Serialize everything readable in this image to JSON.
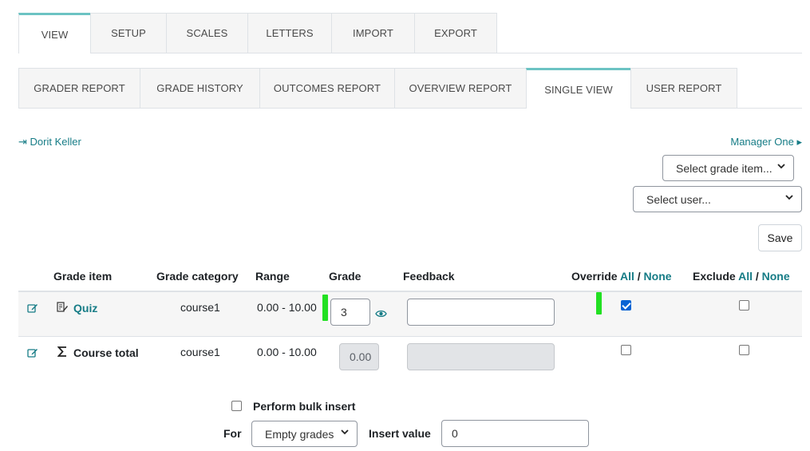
{
  "top_tabs": [
    {
      "label": "VIEW",
      "active": true
    },
    {
      "label": "SETUP",
      "active": false
    },
    {
      "label": "SCALES",
      "active": false
    },
    {
      "label": "LETTERS",
      "active": false
    },
    {
      "label": "IMPORT",
      "active": false
    },
    {
      "label": "EXPORT",
      "active": false
    }
  ],
  "report_tabs": [
    {
      "label": "GRADER REPORT",
      "active": false
    },
    {
      "label": "GRADE HISTORY",
      "active": false
    },
    {
      "label": "OUTCOMES REPORT",
      "active": false
    },
    {
      "label": "OVERVIEW REPORT",
      "active": false
    },
    {
      "label": "SINGLE VIEW",
      "active": true
    },
    {
      "label": "USER REPORT",
      "active": false
    }
  ],
  "nav": {
    "prev_user": "⇥ Dorit Keller",
    "next_user": "Manager One ▸"
  },
  "selectors": {
    "grade_item": "Select grade item...",
    "user": "Select user..."
  },
  "save_label": "Save",
  "table": {
    "headers": {
      "grade_item": "Grade item",
      "grade_category": "Grade category",
      "range": "Range",
      "grade": "Grade",
      "feedback": "Feedback",
      "override": "Override",
      "exclude": "Exclude",
      "all": "All",
      "separator": "/",
      "none": "None"
    },
    "rows": [
      {
        "item": "Quiz",
        "category": "course1",
        "range": "0.00 - 10.00",
        "grade": "3",
        "feedback": "",
        "override": true,
        "exclude": false,
        "icon": "quiz-icon"
      },
      {
        "item": "Course total",
        "category": "course1",
        "range": "0.00 - 10.00",
        "grade": "0.00",
        "feedback": "",
        "override": false,
        "exclude": false,
        "icon": "sigma-icon"
      }
    ]
  },
  "bulk": {
    "label": "Perform bulk insert",
    "checked": false,
    "for_label": "For",
    "for_value": "Empty grades",
    "insert_label": "Insert value",
    "insert_value": "0"
  },
  "colors": {
    "accent": "#167c86",
    "active_tab_border": "#6cc3c3",
    "highlight": "#22e022",
    "checkbox_checked": "#0a64d4"
  }
}
